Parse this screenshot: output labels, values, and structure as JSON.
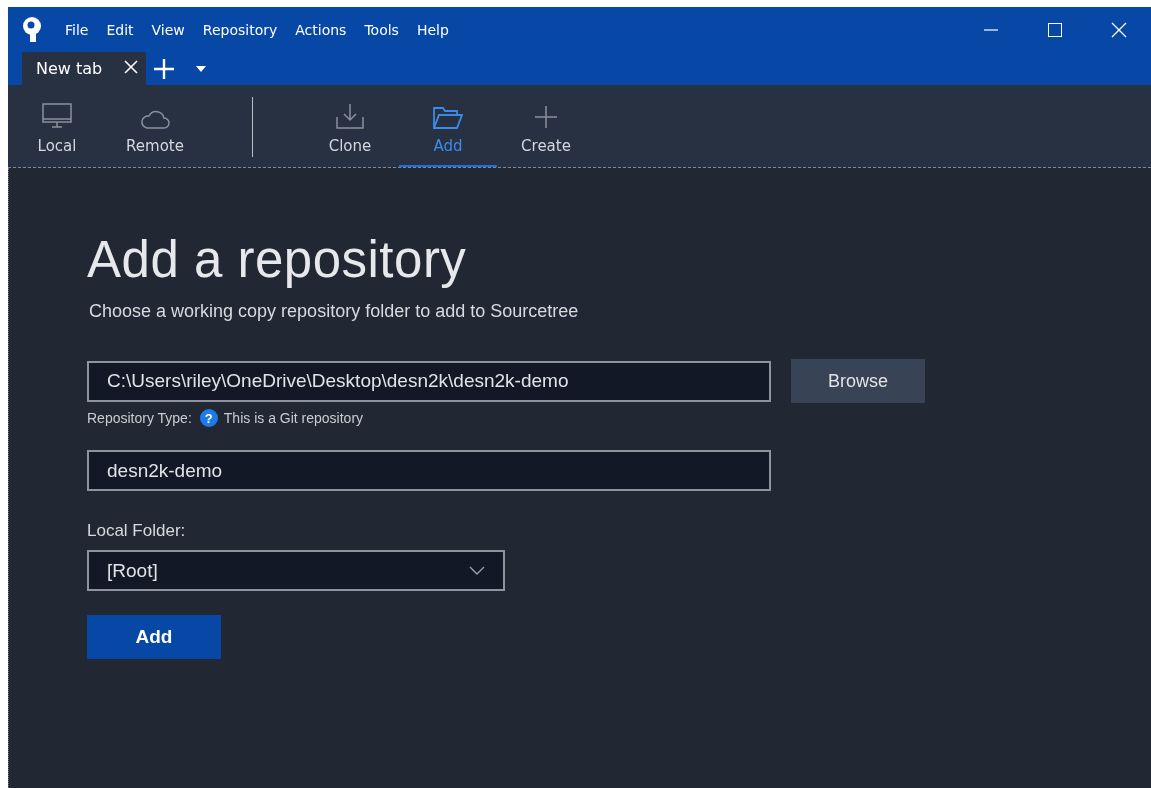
{
  "menu": [
    "File",
    "Edit",
    "View",
    "Repository",
    "Actions",
    "Tools",
    "Help"
  ],
  "tabs": [
    {
      "label": "New tab",
      "selected": true
    }
  ],
  "toolbar": [
    {
      "label": "Local",
      "selected": false
    },
    {
      "label": "Remote",
      "selected": false
    },
    {
      "label": "Clone",
      "selected": false
    },
    {
      "label": "Add",
      "selected": true
    },
    {
      "label": "Create",
      "selected": false
    }
  ],
  "form": {
    "title": "Add a repository",
    "subtitle": "Choose a working copy repository folder to add to Sourcetree",
    "path": "C:\\Users\\riley\\OneDrive\\Desktop\\desn2k\\desn2k-demo",
    "browse": "Browse",
    "repo_type_label": "Repository Type:",
    "repo_type_help": "?",
    "repo_type": "This is a Git repository",
    "name": "desn2k-demo",
    "local_folder_label": "Local Folder:",
    "local_folder": "[Root]",
    "submit": "Add"
  }
}
